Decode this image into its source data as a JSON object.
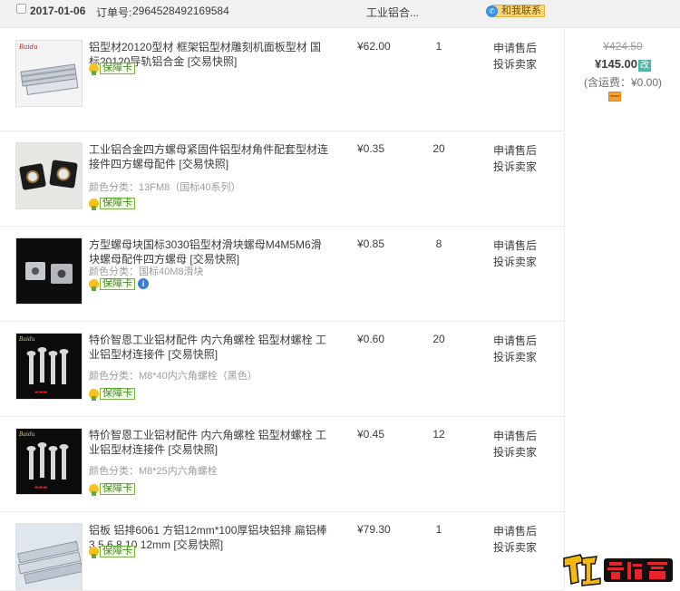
{
  "header": {
    "date": "2017-01-06",
    "order_label": "订单号:",
    "order_number": "2964528492169584",
    "shop_name": "工业铝合...",
    "chat_label": "和我联系"
  },
  "summary": {
    "original_total": "¥424.50",
    "total": "¥145.00",
    "edit_tag": "改",
    "shipping": "(含运费：¥0.00)"
  },
  "items": [
    {
      "title": "铝型材20120型材 框架铝型材雕刻机面板型材 国标20120导轨铝合金",
      "snapshot": "[交易快照]",
      "variant": "",
      "guarantee": "保障卡",
      "price": "¥62.00",
      "quantity": "1",
      "action_after_sale": "申请售后",
      "action_complain": "投诉卖家",
      "thumb": "aluminum-profile"
    },
    {
      "title": "工业铝合金四方螺母紧固件铝型材角件配套型材连接件四方螺母配件",
      "snapshot": "[交易快照]",
      "variant": "颜色分类：13FM8（国标40系列）",
      "guarantee": "保障卡",
      "price": "¥0.35",
      "quantity": "20",
      "action_after_sale": "申请售后",
      "action_complain": "投诉卖家",
      "thumb": "square-nut"
    },
    {
      "title": "方型螺母块国标3030铝型材滑块螺母M4M5M6滑块螺母配件四方螺母",
      "snapshot": "[交易快照]",
      "variant": "颜色分类：国标40M8滑块",
      "guarantee": "保障卡",
      "price": "¥0.85",
      "quantity": "8",
      "action_after_sale": "申请售后",
      "action_complain": "投诉卖家",
      "thumb": "slide-nut"
    },
    {
      "title": "特价智恩工业铝材配件 内六角螺栓 铝型材螺栓 工业铝型材连接件",
      "snapshot": "[交易快照]",
      "variant": "颜色分类：M8*40内六角螺栓（黑色）",
      "guarantee": "保障卡",
      "price": "¥0.60",
      "quantity": "20",
      "action_after_sale": "申请售后",
      "action_complain": "投诉卖家",
      "thumb": "hex-bolt"
    },
    {
      "title": "特价智恩工业铝材配件 内六角螺栓 铝型材螺栓 工业铝型材连接件",
      "snapshot": "[交易快照]",
      "variant": "颜色分类：M8*25内六角螺栓",
      "guarantee": "保障卡",
      "price": "¥0.45",
      "quantity": "12",
      "action_after_sale": "申请售后",
      "action_complain": "投诉卖家",
      "thumb": "hex-bolt"
    },
    {
      "title": "铝板 铝排6061 方铝12mm*100厚铝块铝排 扁铝棒3 5 6 8 10 12mm",
      "snapshot": "[交易快照]",
      "variant": "",
      "guarantee": "保障卡",
      "price": "¥79.30",
      "quantity": "1",
      "action_after_sale": "申请售后",
      "action_complain": "投诉卖家",
      "thumb": "aluminum-plate"
    }
  ],
  "watermark": {
    "text": "木工爱好者"
  },
  "colors": {
    "header_bg": "#f1f1f1",
    "edit_tag": "#4cb7a5",
    "guarantee_green": "#3f8d1a",
    "chat_bg": "#f7d77a"
  }
}
